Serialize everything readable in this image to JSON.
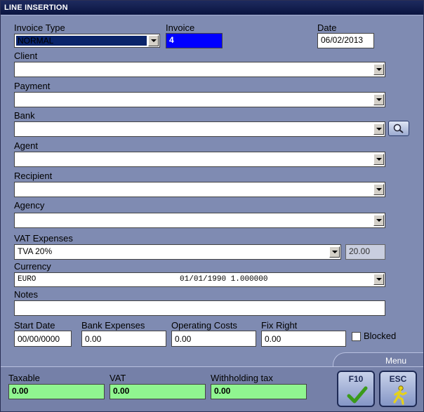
{
  "window": {
    "title": "LINE INSERTION"
  },
  "form": {
    "invoice_type": {
      "label": "Invoice Type",
      "value": "NORMAL"
    },
    "invoice": {
      "label": "Invoice",
      "value": "4"
    },
    "date": {
      "label": "Date",
      "value": "06/02/2013"
    },
    "client": {
      "label": "Client",
      "value": ""
    },
    "payment": {
      "label": "Payment",
      "value": ""
    },
    "bank": {
      "label": "Bank",
      "value": ""
    },
    "agent": {
      "label": "Agent",
      "value": ""
    },
    "recipient": {
      "label": "Recipient",
      "value": ""
    },
    "agency": {
      "label": "Agency",
      "value": ""
    },
    "vat_expenses": {
      "label": "VAT Expenses",
      "value": "TVA 20%",
      "rate": "20.00"
    },
    "currency": {
      "label": "Currency",
      "value": "EURO                               01/01/1990 1.000000"
    },
    "notes": {
      "label": "Notes",
      "value": ""
    },
    "start_date": {
      "label": "Start Date",
      "value": "00/00/0000"
    },
    "bank_expenses": {
      "label": "Bank Expenses",
      "value": "0.00"
    },
    "operating_costs": {
      "label": "Operating Costs",
      "value": "0.00"
    },
    "fix_right": {
      "label": "Fix Right",
      "value": "0.00"
    },
    "blocked": {
      "label": "Blocked",
      "checked": false
    }
  },
  "totals": {
    "taxable": {
      "label": "Taxable",
      "value": "0.00"
    },
    "vat": {
      "label": "VAT",
      "value": "0.00"
    },
    "withholding": {
      "label": "Withholding tax",
      "value": "0.00"
    }
  },
  "menu": {
    "label": "Menu",
    "f10": {
      "key": "F10",
      "icon": "checkmark-icon"
    },
    "esc": {
      "key": "ESC",
      "icon": "running-man-icon"
    }
  },
  "colors": {
    "window_bg": "#7f8bb2",
    "titlebar": "#0a1440",
    "invoice_field": "#0000ff",
    "totals_field": "#90f590"
  }
}
